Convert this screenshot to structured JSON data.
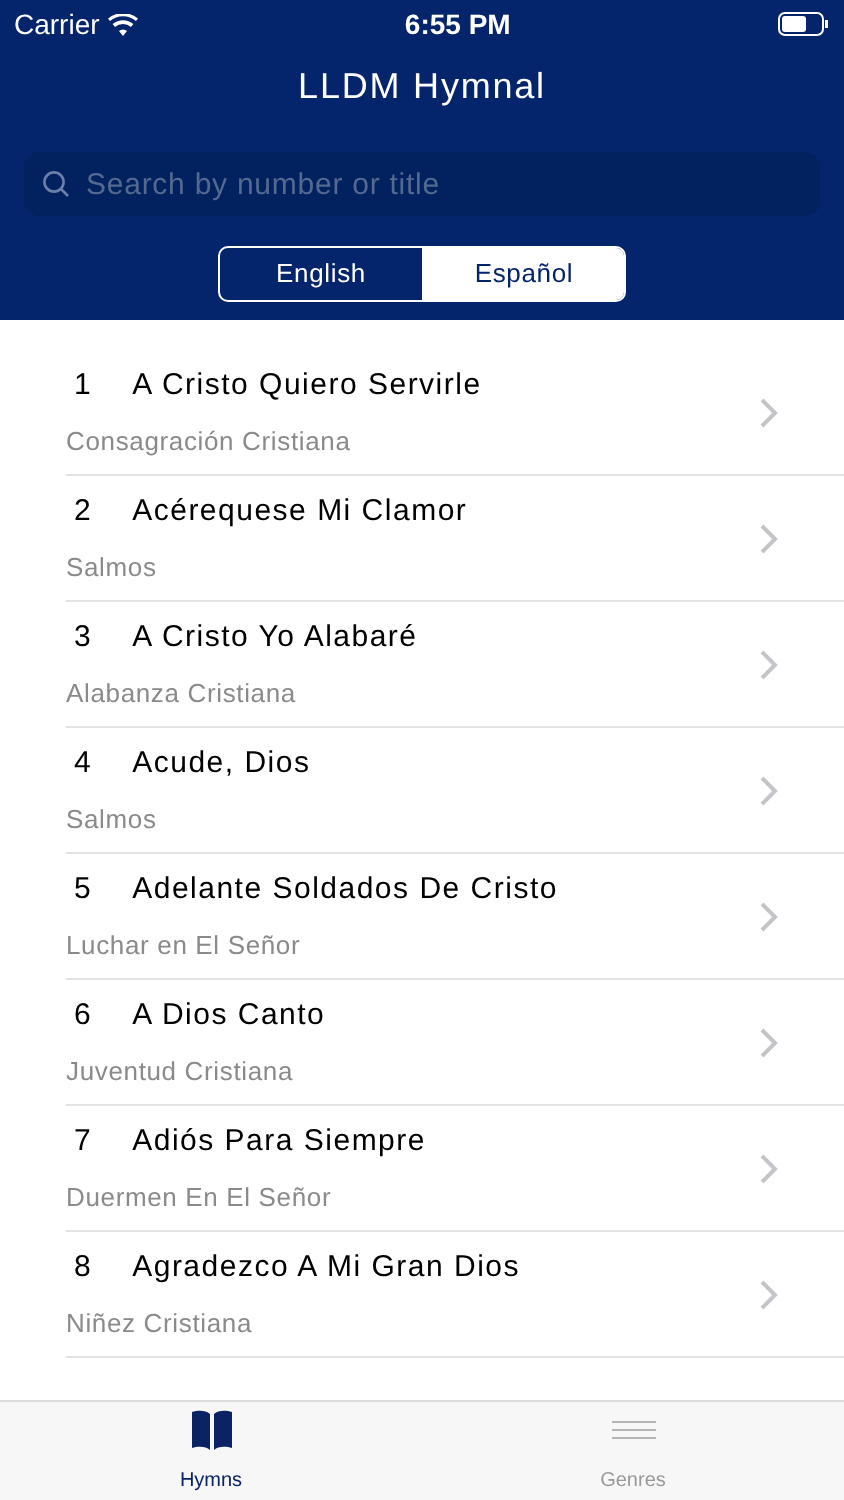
{
  "status_bar": {
    "carrier": "Carrier",
    "time": "6:55 PM"
  },
  "nav": {
    "title": "LLDM Hymnal"
  },
  "search": {
    "placeholder": "Search by number or title"
  },
  "language": [
    {
      "label": "English",
      "selected": false
    },
    {
      "label": "Español",
      "selected": true
    }
  ],
  "hymns": [
    {
      "number": "1",
      "title": "A Cristo Quiero Servirle",
      "genre": "Consagración Cristiana"
    },
    {
      "number": "2",
      "title": "Acérequese Mi Clamor",
      "genre": "Salmos"
    },
    {
      "number": "3",
      "title": "A Cristo Yo Alabaré",
      "genre": "Alabanza Cristiana"
    },
    {
      "number": "4",
      "title": "Acude, Dios",
      "genre": "Salmos"
    },
    {
      "number": "5",
      "title": "Adelante Soldados De Cristo",
      "genre": "Luchar en El Señor"
    },
    {
      "number": "6",
      "title": "A Dios Canto",
      "genre": "Juventud Cristiana"
    },
    {
      "number": "7",
      "title": "Adiós Para Siempre",
      "genre": "Duermen En El Señor"
    },
    {
      "number": "8",
      "title": "Agradezco A Mi Gran Dios",
      "genre": "Niñez Cristiana"
    }
  ],
  "tab_bar": [
    {
      "label": "Hymns",
      "kind": "book",
      "selected": true
    },
    {
      "label": "Genres",
      "kind": "lines",
      "selected": false
    }
  ]
}
